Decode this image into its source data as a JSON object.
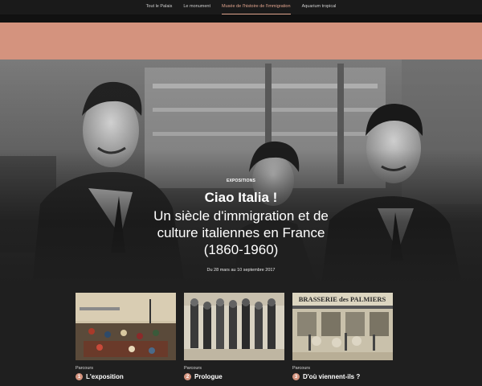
{
  "nav": {
    "items": [
      {
        "label": "Tout le Palais",
        "active": false
      },
      {
        "label": "Le monument",
        "active": false
      },
      {
        "label": "Musée de l'histoire de l'immigration",
        "active": true
      },
      {
        "label": "Aquarium tropical",
        "active": false
      }
    ]
  },
  "colors": {
    "accent": "#d4937e",
    "background": "#1f1f1f",
    "nav_active": "#e0a48e"
  },
  "hero": {
    "eyebrow": "Expositions",
    "title": "Ciao Italia !",
    "subtitle": "Un siècle d'immigration et de culture italiennes en France (1860-1960)",
    "dates": "Du 28 mars au 10 septembre 2017",
    "image_icon": "black-and-white-photo-of-smiling-people"
  },
  "cards": [
    {
      "label": "Parcours",
      "number": "1",
      "title": "L'exposition",
      "image_icon": "painting-harbour-crowd"
    },
    {
      "label": "Parcours",
      "number": "2",
      "title": "Prologue",
      "image_icon": "sepia-group-photo-workers"
    },
    {
      "label": "Parcours",
      "number": "3",
      "title": "D'où viennent-ils ?",
      "image_icon": "postcard-brasserie-des-palmiers",
      "image_caption": "BRASSERIE des PALMIERS"
    }
  ]
}
